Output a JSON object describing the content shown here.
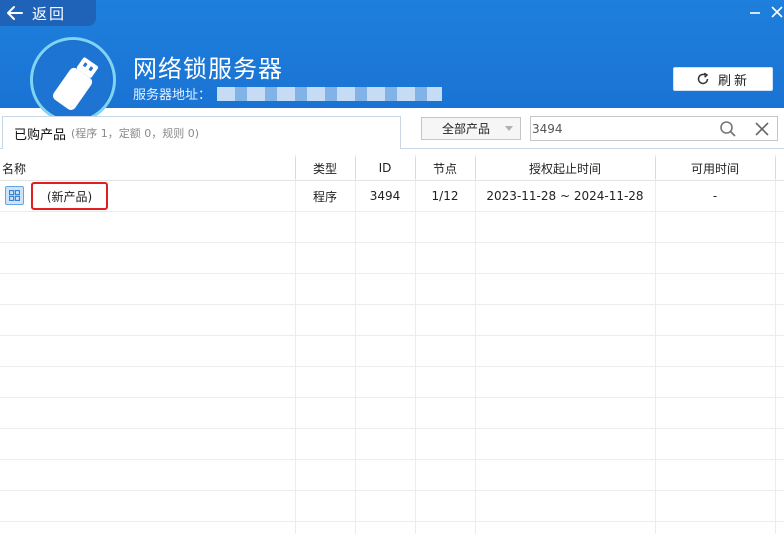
{
  "header": {
    "back_label": "返回",
    "app_title": "网络锁服务器",
    "server_address_label": "服务器地址：",
    "refresh_label": "刷新"
  },
  "tabs": [
    {
      "label": "已购产品",
      "summary": "(程序 1，定额 0，规则 0)"
    }
  ],
  "filter": {
    "selected": "全部产品",
    "search_value": "3494"
  },
  "table": {
    "columns": [
      "名称",
      "类型",
      "ID",
      "节点",
      "授权起止时间",
      "可用时间"
    ],
    "rows": [
      {
        "name": "(新产品)",
        "type": "程序",
        "id": "3494",
        "nodes": "1/12",
        "period": "2023-11-28 ~ 2024-11-28",
        "available": "-"
      }
    ]
  },
  "icons": {
    "back": "arrow-left-icon",
    "minimize": "minimize-icon",
    "close": "close-icon",
    "logo": "usb-dongle-icon",
    "refresh": "refresh-icon",
    "dropdown": "chevron-down-icon",
    "search": "search-icon",
    "clear": "clear-icon",
    "product": "grid-icon"
  },
  "colors": {
    "header_bg": "#1a73d4",
    "highlight_border": "#e02020"
  }
}
